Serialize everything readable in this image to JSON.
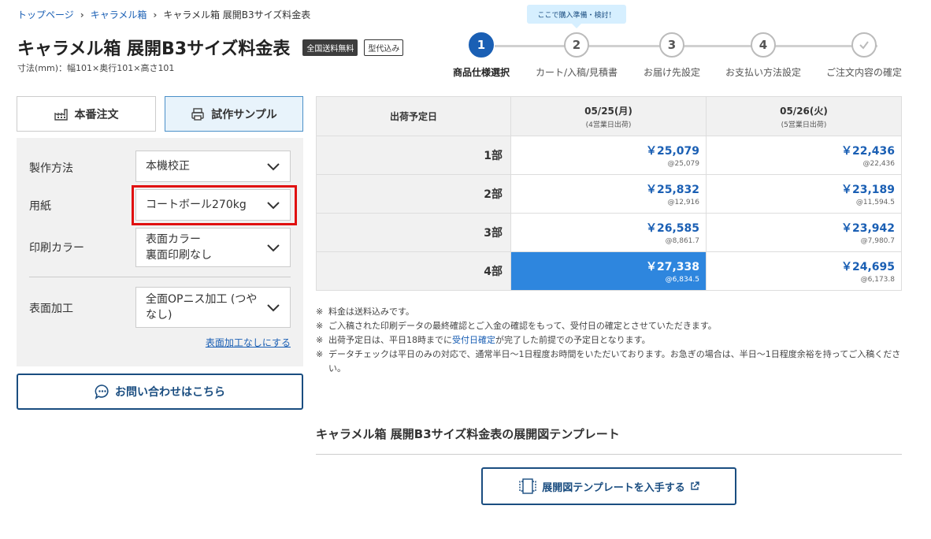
{
  "breadcrumb": {
    "items": [
      "トップページ",
      "キャラメル箱"
    ],
    "current": "キャラメル箱 展開B3サイズ料金表"
  },
  "header": {
    "title": "キャラメル箱 展開B3サイズ料金表",
    "badge_shipping": "全国送料無料",
    "badge_mold": "型代込み",
    "dimensions": "寸法(mm)：幅101×奥行101×高さ101"
  },
  "steps": {
    "tooltip": "ここで購入準備・検討！",
    "items": [
      {
        "num": "1",
        "label": "商品仕様選択"
      },
      {
        "num": "2",
        "label": "カート/入稿/見積書"
      },
      {
        "num": "3",
        "label": "お届け先設定"
      },
      {
        "num": "4",
        "label": "お支払い方法設定"
      },
      {
        "num": "",
        "label": "ご注文内容の確定"
      }
    ]
  },
  "tabs": {
    "production": "本番注文",
    "sample": "試作サンプル"
  },
  "options": {
    "method": {
      "label": "製作方法",
      "value": "本機校正"
    },
    "paper": {
      "label": "用紙",
      "value": "コートボール270kg"
    },
    "color": {
      "label": "印刷カラー",
      "value_line1": "表面カラー",
      "value_line2": "裏面印刷なし"
    },
    "finish": {
      "label": "表面加工",
      "value": "全面OPニス加工 (つやなし)"
    },
    "reset_link": "表面加工なしにする"
  },
  "contact_button": "お問い合わせはこちら",
  "table": {
    "header": "出荷予定日",
    "columns": [
      {
        "date": "05/25(月)",
        "sub": "(4営業日出荷)"
      },
      {
        "date": "05/26(火)",
        "sub": "(5営業日出荷)"
      }
    ],
    "rows": [
      {
        "qty": "1部",
        "prices": [
          {
            "total": "￥25,079",
            "unit": "@25,079"
          },
          {
            "total": "￥22,436",
            "unit": "@22,436"
          }
        ]
      },
      {
        "qty": "2部",
        "prices": [
          {
            "total": "￥25,832",
            "unit": "@12,916"
          },
          {
            "total": "￥23,189",
            "unit": "@11,594.5"
          }
        ]
      },
      {
        "qty": "3部",
        "prices": [
          {
            "total": "￥26,585",
            "unit": "@8,861.7"
          },
          {
            "total": "￥23,942",
            "unit": "@7,980.7"
          }
        ]
      },
      {
        "qty": "4部",
        "prices": [
          {
            "total": "￥27,338",
            "unit": "@6,834.5"
          },
          {
            "total": "￥24,695",
            "unit": "@6,173.8"
          }
        ]
      }
    ]
  },
  "notes": {
    "mark": "※",
    "n1": "料金は送料込みです。",
    "n2": "ご入稿された印刷データの最終確認とご入金の確認をもって、受付日の確定とさせていただきます。",
    "n3_pre": "出荷予定日は、平日18時までに",
    "n3_link": "受付日確定",
    "n3_post": "が完了した前提での予定日となります。",
    "n4": "データチェックは平日のみの対応で、通常半日〜1日程度お時間をいただいております。お急ぎの場合は、半日〜1日程度余裕を持ってご入稿ください。"
  },
  "template_section": {
    "title": "キャラメル箱 展開B3サイズ料金表の展開図テンプレート",
    "button": "展開図テンプレートを入手する"
  },
  "colors": {
    "accent": "#1a5fb4",
    "selected_cell": "#2e86de",
    "highlight": "#e01010"
  }
}
